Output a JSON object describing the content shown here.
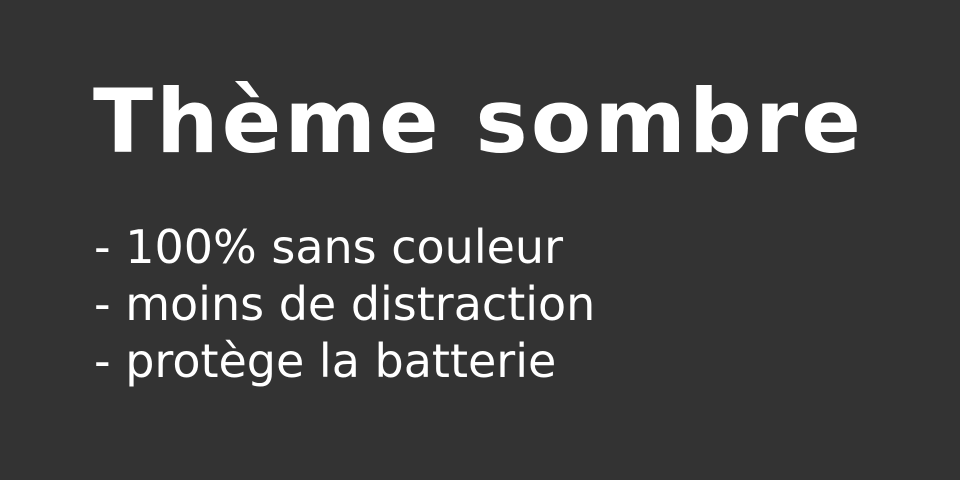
{
  "slide": {
    "title": "Thème sombre",
    "bullets": [
      "- 100% sans couleur",
      "- moins de distraction",
      "- protège la batterie"
    ]
  },
  "colors": {
    "background": "#333333",
    "text": "#ffffff"
  }
}
